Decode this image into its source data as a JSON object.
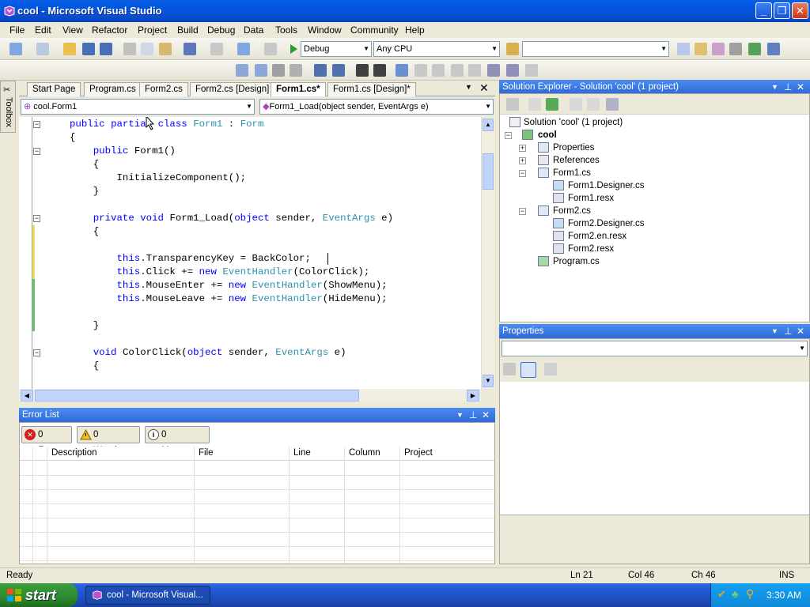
{
  "window": {
    "title": "cool - Microsoft Visual Studio",
    "controls": {
      "minimize": "_",
      "maximize": "❐",
      "close": "✕"
    }
  },
  "menu": [
    "File",
    "Edit",
    "View",
    "Refactor",
    "Project",
    "Build",
    "Debug",
    "Data",
    "Tools",
    "Window",
    "Community",
    "Help"
  ],
  "toolbar": {
    "config": "Debug",
    "platform": "Any CPU",
    "find": ""
  },
  "editor": {
    "tabs": [
      "Start Page",
      "Program.cs",
      "Form2.cs",
      "Form2.cs [Design]",
      "Form1.cs*",
      "Form1.cs [Design]*"
    ],
    "active_tab": "Form1.cs*",
    "type_dropdown": "cool.Form1",
    "member_dropdown": "Form1_Load(object sender, EventArgs e)",
    "toolbox_label": "Toolbox"
  },
  "code": [
    {
      "parts": [
        [
          "kw",
          "public "
        ],
        [
          "kw",
          "partial "
        ],
        [
          "kw",
          "class "
        ],
        [
          "ty",
          "Form1"
        ],
        [
          "p",
          " : "
        ],
        [
          "ty",
          "Form"
        ]
      ]
    },
    {
      "parts": [
        [
          "p",
          "{"
        ]
      ]
    },
    {
      "parts": [
        [
          "p",
          "    "
        ],
        [
          "kw",
          "public "
        ],
        [
          "p",
          "Form1()"
        ]
      ]
    },
    {
      "parts": [
        [
          "p",
          "    {"
        ]
      ]
    },
    {
      "parts": [
        [
          "p",
          "        InitializeComponent();"
        ]
      ]
    },
    {
      "parts": [
        [
          "p",
          "    }"
        ]
      ]
    },
    {
      "parts": [
        [
          "p",
          ""
        ]
      ]
    },
    {
      "parts": [
        [
          "p",
          "    "
        ],
        [
          "kw",
          "private "
        ],
        [
          "kw",
          "void "
        ],
        [
          "p",
          "Form1_Load("
        ],
        [
          "kw",
          "object "
        ],
        [
          "p",
          "sender, "
        ],
        [
          "ty",
          "EventArgs "
        ],
        [
          "p",
          "e)"
        ]
      ]
    },
    {
      "parts": [
        [
          "p",
          "    {"
        ]
      ]
    },
    {
      "parts": [
        [
          "p",
          ""
        ]
      ]
    },
    {
      "parts": [
        [
          "p",
          "        "
        ],
        [
          "kw",
          "this"
        ],
        [
          "p",
          ".TransparencyKey = BackColor;"
        ]
      ]
    },
    {
      "parts": [
        [
          "p",
          "        "
        ],
        [
          "kw",
          "this"
        ],
        [
          "p",
          ".Click += "
        ],
        [
          "kw",
          "new "
        ],
        [
          "ty",
          "EventHandler"
        ],
        [
          "p",
          "(ColorClick);"
        ]
      ]
    },
    {
      "parts": [
        [
          "p",
          "        "
        ],
        [
          "kw",
          "this"
        ],
        [
          "p",
          ".MouseEnter += "
        ],
        [
          "kw",
          "new "
        ],
        [
          "ty",
          "EventHandler"
        ],
        [
          "p",
          "(ShowMenu);"
        ]
      ]
    },
    {
      "parts": [
        [
          "p",
          "        "
        ],
        [
          "kw",
          "this"
        ],
        [
          "p",
          ".MouseLeave += "
        ],
        [
          "kw",
          "new "
        ],
        [
          "ty",
          "EventHandler"
        ],
        [
          "p",
          "(HideMenu);"
        ]
      ]
    },
    {
      "parts": [
        [
          "p",
          ""
        ]
      ]
    },
    {
      "parts": [
        [
          "p",
          "    }"
        ]
      ]
    },
    {
      "parts": [
        [
          "p",
          ""
        ]
      ]
    },
    {
      "parts": [
        [
          "p",
          "    "
        ],
        [
          "kw",
          "void "
        ],
        [
          "p",
          "ColorClick("
        ],
        [
          "kw",
          "object "
        ],
        [
          "p",
          "sender, "
        ],
        [
          "ty",
          "EventArgs "
        ],
        [
          "p",
          "e)"
        ]
      ]
    },
    {
      "parts": [
        [
          "p",
          "    {"
        ]
      ]
    }
  ],
  "solution_explorer": {
    "title": "Solution Explorer - Solution 'cool' (1 project)",
    "items": [
      "Solution 'cool' (1 project)",
      "cool",
      "Properties",
      "References",
      "Form1.cs",
      "Form1.Designer.cs",
      "Form1.resx",
      "Form2.cs",
      "Form2.Designer.cs",
      "Form2.en.resx",
      "Form2.resx",
      "Program.cs"
    ]
  },
  "properties": {
    "title": "Properties"
  },
  "error_list": {
    "title": "Error List",
    "errors": "0 Errors",
    "warnings": "0 Warnings",
    "messages": "0 Messages",
    "columns": [
      "Description",
      "File",
      "Line",
      "Column",
      "Project"
    ]
  },
  "status": {
    "text": "Ready",
    "line": "Ln 21",
    "col": "Col 46",
    "ch": "Ch 46",
    "mode": "INS"
  },
  "taskbar": {
    "start": "start",
    "task": "cool - Microsoft Visual...",
    "clock": "3:30 AM"
  }
}
